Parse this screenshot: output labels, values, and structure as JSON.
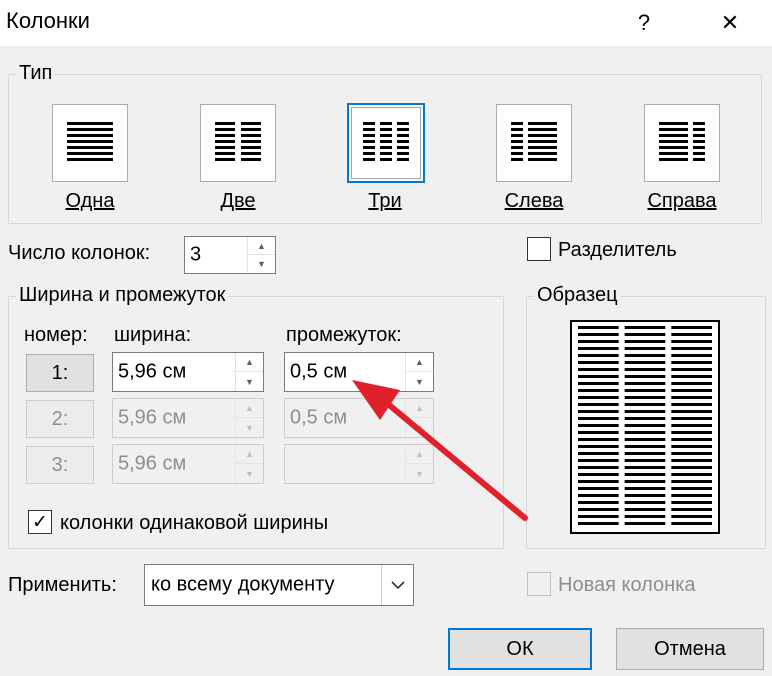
{
  "window": {
    "title": "Колонки",
    "help_glyph": "?",
    "close_glyph": "✕"
  },
  "type_group": {
    "legend": "Тип",
    "presets": [
      {
        "label": "Одна",
        "icon": "one-column-icon",
        "selected": false
      },
      {
        "label": "Две",
        "icon": "two-columns-icon",
        "selected": false
      },
      {
        "label": "Три",
        "icon": "three-columns-icon",
        "selected": true
      },
      {
        "label": "Слева",
        "icon": "left-column-icon",
        "selected": false
      },
      {
        "label": "Справа",
        "icon": "right-column-icon",
        "selected": false
      }
    ]
  },
  "column_count": {
    "label": "Число колонок:",
    "value": "3"
  },
  "separator": {
    "label": "Разделитель",
    "checked": false
  },
  "width_spacing": {
    "legend": "Ширина и промежуток",
    "col_number_header": "номер:",
    "width_header": "ширина:",
    "spacing_header": "промежуток:",
    "rows": [
      {
        "number": "1:",
        "width": "5,96 см",
        "spacing": "0,5 см",
        "enabled": true
      },
      {
        "number": "2:",
        "width": "5,96 см",
        "spacing": "0,5 см",
        "enabled": false
      },
      {
        "number": "3:",
        "width": "5,96 см",
        "spacing": "",
        "enabled": false
      }
    ]
  },
  "equal_width": {
    "label": "колонки одинаковой ширины",
    "checked": true,
    "check_glyph": "✓"
  },
  "preview": {
    "legend": "Образец"
  },
  "apply": {
    "label": "Применить:",
    "value": "ко всему документу"
  },
  "new_column": {
    "label": "Новая колонка",
    "checked": false
  },
  "buttons": {
    "ok": "ОК",
    "cancel": "Отмена"
  },
  "colors": {
    "accent": "#0078d7",
    "annotation_arrow": "#e0202a"
  }
}
